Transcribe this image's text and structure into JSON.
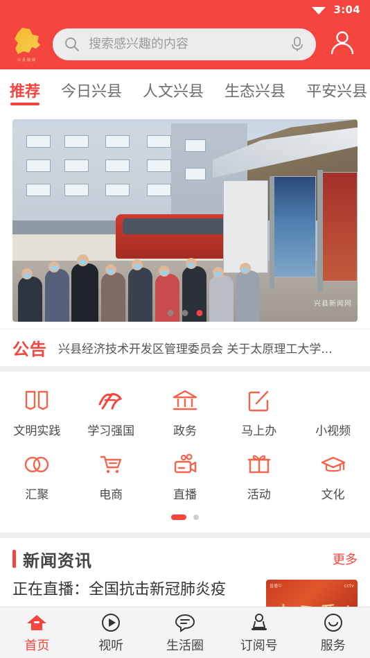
{
  "status_bar": {
    "time": "3:04",
    "wifi_icon": "wifi-icon"
  },
  "header": {
    "logo_caption": "兴县融媒",
    "search": {
      "placeholder": "搜索感兴趣的内容",
      "value": "",
      "search_icon": "search-icon",
      "mic_icon": "microphone-icon"
    },
    "profile_icon": "user-avatar-icon",
    "background_color": "#f4453f"
  },
  "tabs": [
    {
      "label": "推荐",
      "active": true
    },
    {
      "label": "今日兴县",
      "active": false
    },
    {
      "label": "人文兴县",
      "active": false
    },
    {
      "label": "生态兴县",
      "active": false
    },
    {
      "label": "平安兴县",
      "active": false
    }
  ],
  "carousel": {
    "watermark": "兴县新闻网",
    "slide_count": 3,
    "active_slide": 3
  },
  "announcement": {
    "badge": "公告",
    "text": "兴县经济技术开发区管理委员会 关于太原理工大学..."
  },
  "grid": {
    "rows": [
      [
        {
          "label": "文明实践",
          "icon": "open-book-icon"
        },
        {
          "label": "学习强国",
          "icon": "xuexi-calligraphy-icon"
        },
        {
          "label": "政务",
          "icon": "government-building-icon"
        },
        {
          "label": "马上办",
          "icon": "edit-square-icon"
        },
        {
          "label": "小视频",
          "icon": "missing-icon"
        }
      ],
      [
        {
          "label": "汇聚",
          "icon": "two-circles-icon"
        },
        {
          "label": "电商",
          "icon": "shopping-cart-icon"
        },
        {
          "label": "直播",
          "icon": "video-camera-icon"
        },
        {
          "label": "活动",
          "icon": "gift-icon"
        },
        {
          "label": "文化",
          "icon": "graduation-cap-icon"
        }
      ]
    ],
    "page_count": 2,
    "active_page": 1
  },
  "news": {
    "section_title": "新闻资讯",
    "more_label": "更多",
    "items": [
      {
        "title": "正在直播：全国抗击新冠肺炎疫",
        "thumb_logo": "cctv-logo",
        "thumb_corner": "直播中"
      }
    ]
  },
  "bottom_nav": [
    {
      "label": "首页",
      "icon": "home-icon",
      "active": true
    },
    {
      "label": "视听",
      "icon": "play-circle-icon",
      "active": false
    },
    {
      "label": "生活圈",
      "icon": "chat-bubble-icon",
      "active": false
    },
    {
      "label": "订阅号",
      "icon": "stamp-icon",
      "active": false
    },
    {
      "label": "服务",
      "icon": "smiley-circle-icon",
      "active": false
    }
  ],
  "colors": {
    "brand_red": "#f4453f",
    "icon_orange": "#f4644a",
    "text_dark": "#444444"
  }
}
